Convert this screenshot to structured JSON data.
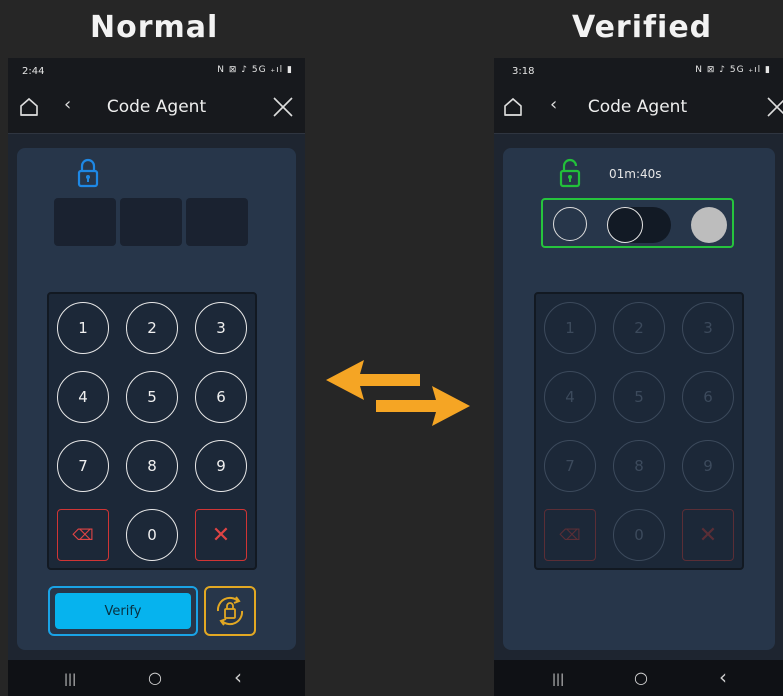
{
  "headings": {
    "left": "Normal",
    "right": "Verified"
  },
  "phones": {
    "normal": {
      "status_time": "2:44",
      "status_icons": "N ⊠ ♪ 5G ₊ıl ▮",
      "title": "Code Agent",
      "keys": [
        "1",
        "2",
        "3",
        "4",
        "5",
        "6",
        "7",
        "8",
        "9",
        "⌫",
        "0",
        "✕"
      ],
      "verify_label": "Verify"
    },
    "verified": {
      "status_time": "3:18",
      "status_icons": "N ⊠ ♪ 5G ₊ıl ▮",
      "title": "Code Agent",
      "timer": "01m:40s",
      "keys": [
        "1",
        "2",
        "3",
        "4",
        "5",
        "6",
        "7",
        "8",
        "9",
        "⌫",
        "0",
        "✕"
      ]
    }
  },
  "nav": {
    "recent": "|||",
    "home": "○",
    "back": "‹"
  },
  "colors": {
    "lock_blue": "#1e88e5",
    "lock_green": "#22c03a",
    "verify": "#06b3ee",
    "accent_orange": "#f5a524",
    "delete_red": "#d03535"
  }
}
